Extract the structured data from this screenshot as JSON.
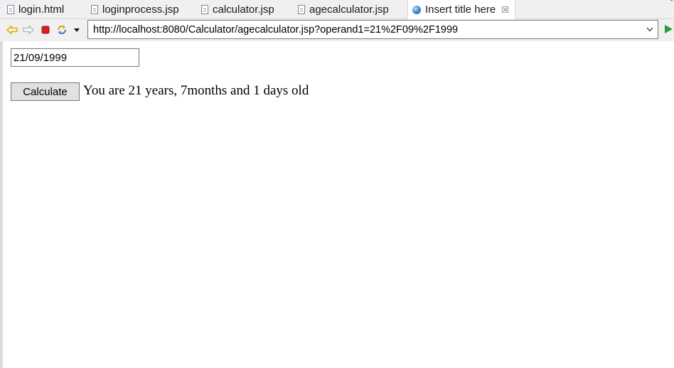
{
  "tabs": [
    {
      "label": "login.html",
      "icon": "file-icon",
      "active": false
    },
    {
      "label": "loginprocess.jsp",
      "icon": "file-icon",
      "active": false
    },
    {
      "label": "calculator.jsp",
      "icon": "file-icon",
      "active": false
    },
    {
      "label": "agecalculator.jsp",
      "icon": "file-icon",
      "active": false
    },
    {
      "label": "Insert title here",
      "icon": "globe-icon",
      "active": true,
      "close_glyph": "☒"
    }
  ],
  "toolbar": {
    "buttons": [
      "back-arrow-icon",
      "forward-arrow-icon",
      "stop-icon",
      "refresh-icon",
      "dropdown-arrow-icon"
    ],
    "url": "http://localhost:8080/Calculator/agecalculator.jsp?operand1=21%2F09%2F1999",
    "go_button": "go-arrow-icon"
  },
  "form": {
    "date_value": "21/09/1999",
    "calculate_label": "Calculate",
    "result_text": "You are 21 years, 7months and 1 days old"
  },
  "colors": {
    "back_arrow": "#e0a000",
    "stop": "#d81e2a",
    "refresh": "#e09a00",
    "go": "#2e9a3a"
  }
}
